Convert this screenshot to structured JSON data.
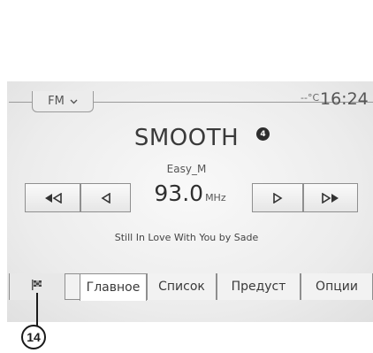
{
  "header": {
    "band": "FM",
    "band_chevron_icon": "chevron-down-icon",
    "temperature": "--°C",
    "time": "16:24"
  },
  "station": {
    "name": "SMOOTH",
    "preset_badge": "4",
    "ps_name": "Easy_M",
    "frequency": "93.0",
    "frequency_unit": "MHz",
    "now_playing": "Still In Love With You by Sade"
  },
  "controls": {
    "seek_back_icon": "fast-rewind-icon",
    "step_back_icon": "step-back-icon",
    "step_forward_icon": "step-forward-icon",
    "seek_forward_icon": "fast-forward-icon"
  },
  "tabs": {
    "flag_icon": "checkered-flag-icon",
    "items": [
      "Главное",
      "Список",
      "Предуст",
      "Опции"
    ]
  },
  "callout": {
    "label": "14"
  }
}
